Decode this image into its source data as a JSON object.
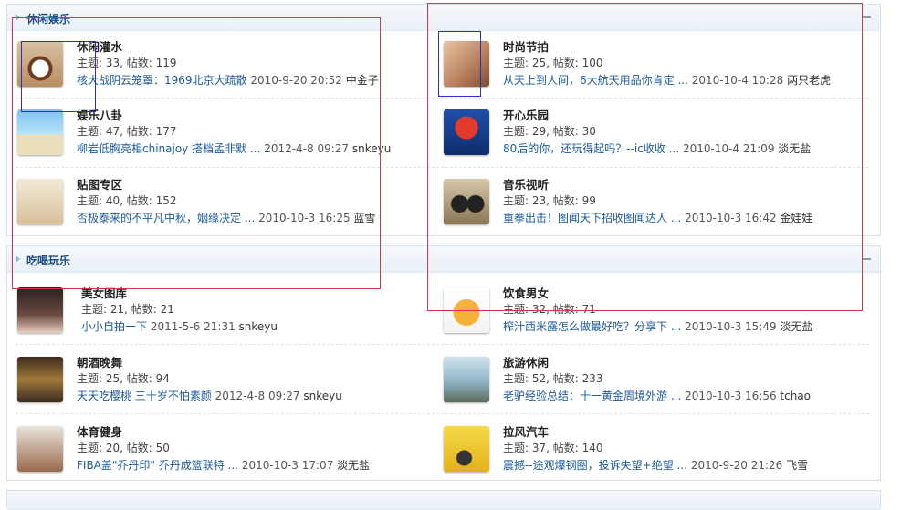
{
  "sections": [
    {
      "title": "休闲娱乐",
      "forums": [
        {
          "name": "休闲灌水",
          "stats": "主题: 33, 帖数: 119",
          "last_post": "核大战阴云笼罩：1969北京大疏散",
          "last_time": "2010-9-20 20:52",
          "last_user": "中金子",
          "icon": "coffee-cup-icon"
        },
        {
          "name": "时尚节拍",
          "stats": "主题: 25, 帖数: 100",
          "last_post": "从天上到人间，6大航天用品你肯定 ...",
          "last_time": "2010-10-4 10:28",
          "last_user": "两只老虎",
          "icon": "vogue-cover-icon"
        },
        {
          "name": "娱乐八卦",
          "stats": "主题: 47, 帖数: 177",
          "last_post": "柳岩低胸亮相chinajoy 搭档孟非默 ...",
          "last_time": "2012-4-8 09:27",
          "last_user": "snkeyu",
          "icon": "beach-jump-icon"
        },
        {
          "name": "开心乐园",
          "stats": "主题: 29, 帖数: 30",
          "last_post": "80后的你，还玩得起吗？--ic收收 ...",
          "last_time": "2010-10-4 21:09",
          "last_user": "淡无盐",
          "icon": "mario-icon"
        },
        {
          "name": "贴图专区",
          "stats": "主题: 40, 帖数: 152",
          "last_post": "否极泰来的不平凡中秋，姻缘决定 ...",
          "last_time": "2010-10-3 16:25",
          "last_user": "蓝雪",
          "icon": "photo-frame-icon"
        },
        {
          "name": "音乐视听",
          "stats": "主题: 23, 帖数: 99",
          "last_post": "重拳出击！图闻天下招收图闻达人 ...",
          "last_time": "2010-10-3 16:42",
          "last_user": "金娃娃",
          "icon": "headphones-icon"
        }
      ]
    },
    {
      "title": "吃喝玩乐",
      "forums": [
        {
          "name": "美女图库",
          "stats": "主题: 21, 帖数: 21",
          "last_post": "小小自拍一下",
          "last_time": "2011-5-6 21:31",
          "last_user": "snkeyu",
          "icon": "girl-portrait-icon"
        },
        {
          "name": "饮食男女",
          "stats": "主题: 32, 帖数: 71",
          "last_post": "榨汁西米露怎么做最好吃？分享下 ...",
          "last_time": "2010-10-3 15:49",
          "last_user": "淡无盐",
          "icon": "chef-icon"
        },
        {
          "name": "朝酒晚舞",
          "stats": "主题: 25, 帖数: 94",
          "last_post": "天天吃樱桃 三十岁不怕素颜",
          "last_time": "2012-4-8 09:27",
          "last_user": "snkeyu",
          "icon": "hollywood-icon"
        },
        {
          "name": "旅游休闲",
          "stats": "主题: 52, 帖数: 233",
          "last_post": "老驴经验总结：十一黄金周境外游 ...",
          "last_time": "2010-10-3 16:56",
          "last_user": "tchao",
          "icon": "group-photo-icon"
        },
        {
          "name": "体育健身",
          "stats": "主题: 20, 帖数: 50",
          "last_post": "FIBA盖\"乔丹印\" 乔丹成篮联特 ...",
          "last_time": "2010-10-3 17:07",
          "last_user": "淡无盐",
          "icon": "basketball-icon"
        },
        {
          "name": "拉风汽车",
          "stats": "主题: 37, 帖数: 140",
          "last_post": "震撼--途观爆钢圈，投诉失望+绝望 ...",
          "last_time": "2010-9-20 21:26",
          "last_user": "飞雪",
          "icon": "sports-car-icon"
        }
      ]
    }
  ],
  "colors": {
    "link": "#1c5aa0",
    "section_title": "#1b4c83",
    "annotation_red": "#e0304a",
    "annotation_blue": "#2a32b8"
  }
}
